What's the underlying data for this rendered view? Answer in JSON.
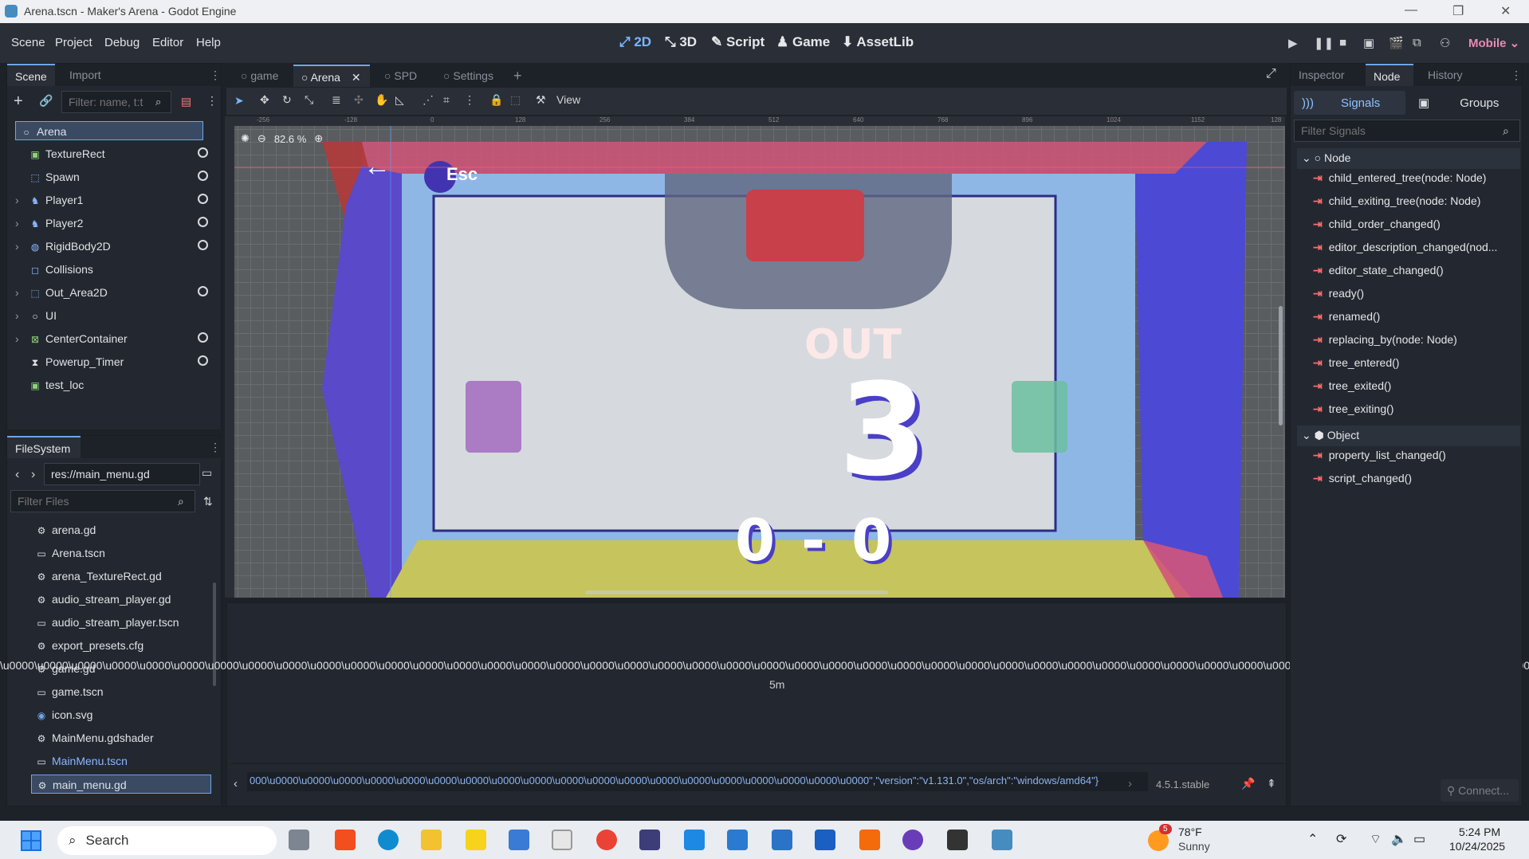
{
  "window": {
    "title": "Arena.tscn - Maker's Arena - Godot Engine"
  },
  "menubar": {
    "menus": [
      "Scene",
      "Project",
      "Debug",
      "Editor",
      "Help"
    ],
    "workspaces": [
      "2D",
      "3D",
      "Script",
      "Game",
      "AssetLib"
    ],
    "active_workspace": "2D",
    "renderer": "Mobile"
  },
  "scene_dock": {
    "tabs": [
      "Scene",
      "Import"
    ],
    "filter_placeholder": "Filter: name, t:t",
    "nodes": [
      {
        "label": "Arena",
        "icon": "node-icon",
        "selected": true
      },
      {
        "label": "TextureRect",
        "icon": "texture-rect-icon"
      },
      {
        "label": "Spawn",
        "icon": "reference-rect-icon"
      },
      {
        "label": "Player1",
        "icon": "character-icon"
      },
      {
        "label": "Player2",
        "icon": "character-icon"
      },
      {
        "label": "RigidBody2D",
        "icon": "rigidbody-icon"
      },
      {
        "label": "Collisions",
        "icon": "node2d-icon"
      },
      {
        "label": "Out_Area2D",
        "icon": "area2d-icon"
      },
      {
        "label": "UI",
        "icon": "node-icon"
      },
      {
        "label": "CenterContainer",
        "icon": "container-icon"
      },
      {
        "label": "Powerup_Timer",
        "icon": "timer-icon"
      },
      {
        "label": "test_loc",
        "icon": "texture-rect-icon"
      }
    ]
  },
  "filesystem": {
    "title": "FileSystem",
    "path": "res://main_menu.gd",
    "filter_placeholder": "Filter Files",
    "files": [
      "arena.gd",
      "Arena.tscn",
      "arena_TextureRect.gd",
      "audio_stream_player.gd",
      "audio_stream_player.tscn",
      "export_presets.cfg",
      "game.gd",
      "game.tscn",
      "icon.svg",
      "MainMenu.gdshader",
      "MainMenu.tscn",
      "main_menu.gd"
    ],
    "selected": "main_menu.gd"
  },
  "editor_tabs": [
    "game",
    "Arena",
    "SPD",
    "Settings"
  ],
  "toolbar": {
    "view_label": "View"
  },
  "viewport": {
    "zoom": "82.6 %",
    "ruler_ticks": [
      "-256",
      "-128",
      "0",
      "128",
      "256",
      "384",
      "512",
      "640",
      "768",
      "896",
      "1024",
      "1152",
      "128"
    ],
    "game_out_text": "OUT",
    "game_count": "3",
    "score": "0 - 0",
    "esc_label": "Esc"
  },
  "bottom_panel": {
    "garbled_line": "\\u0000\\u0000\\u0000\\u0000\\u0000\\u0000\\u0000\\u0000\\u0000\\u0000\\u0000\\u0000\\u0000\\u0000\\u0000\\u0000\\u0000\\u0000\\u0000\\u0000\\u0000\\u0000\\u0000\\u0000\\u0000\\u0000\\u0000\\u0000\\u0000\\u0000\\u0000\\u0000\\u0000\\u0000\\u0000\\u0000\\u0000\\u0000\\u0000\\u0000\\u0000\\u0000\\u0000\\u0000\\u0000\\u0000\\u0000\\u0000\\u0000\\u0000\\u0000\\u0000\\u0000\\u0000\\u0000\\u0000\\u0000\\u0000\\u0000\\u0000\\u0000\\u0000",
    "timestamp": "5m",
    "status_line": "000\\u0000\\u0000\\u0000\\u0000\\u0000\\u0000\\u0000\\u0000\\u0000\\u0000\\u0000\\u0000\\u0000\\u0000\\u0000\\u0000\\u0000\\u0000\\u0000\",\"version\":\"v1.131.0\",\"os/arch\":\"windows/amd64\"}",
    "version": "4.5.1.stable"
  },
  "node_dock": {
    "tabs": [
      "Inspector",
      "Node",
      "History"
    ],
    "subtabs": [
      "Signals",
      "Groups"
    ],
    "filter_placeholder": "Filter Signals",
    "groups": [
      {
        "name": "Node",
        "signals": [
          "child_entered_tree(node: Node)",
          "child_exiting_tree(node: Node)",
          "child_order_changed()",
          "editor_description_changed(nod...",
          "editor_state_changed()",
          "ready()",
          "renamed()",
          "replacing_by(node: Node)",
          "tree_entered()",
          "tree_exited()",
          "tree_exiting()"
        ]
      },
      {
        "name": "Object",
        "signals": [
          "property_list_changed()",
          "script_changed()"
        ]
      }
    ],
    "connect_label": "Connect..."
  },
  "taskbar": {
    "search_placeholder": "Search",
    "weather_temp": "78°F",
    "weather_desc": "Sunny",
    "weather_badge": "5",
    "time": "5:24 PM",
    "date": "10/24/2025"
  }
}
